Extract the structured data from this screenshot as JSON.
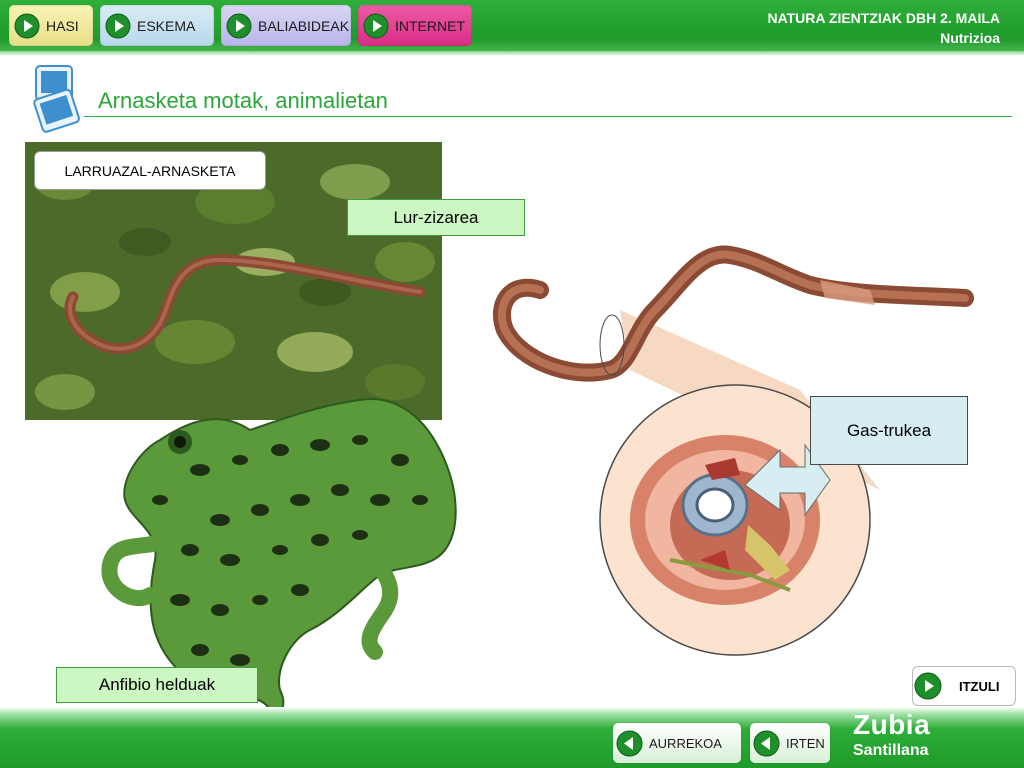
{
  "nav": {
    "hasi": "HASI",
    "eskema": "ESKEMA",
    "baliabideak": "BALIABIDEAK",
    "internet": "INTERNET"
  },
  "course": {
    "line1": "NATURA ZIENTZIAK DBH 2. MAILA",
    "line2": "Nutrizioa"
  },
  "page_title": "Arnasketa motak, animalietan",
  "labels": {
    "section": "LARRUAZAL-ARNASKETA",
    "worm": "Lur-zizarea",
    "gas_exchange": "Gas-trukea",
    "amphibians": "Anfibio helduak"
  },
  "buttons": {
    "itzuli": "ITZULI",
    "aurrekoa": "AURREKOA",
    "irten": "IRTEN"
  },
  "brand": {
    "name": "Zubia",
    "sub": "Santillana"
  },
  "icons": {
    "nav": "play-right-icon",
    "back": "play-left-icon",
    "title": "slides-icon"
  },
  "colors": {
    "header_green": "#1f9a2b",
    "title_green": "#2aa63a",
    "label_green_bg": "#ccf7c2",
    "gas_label_bg": "#d6edf1",
    "internet_pink": "#d92c86"
  }
}
